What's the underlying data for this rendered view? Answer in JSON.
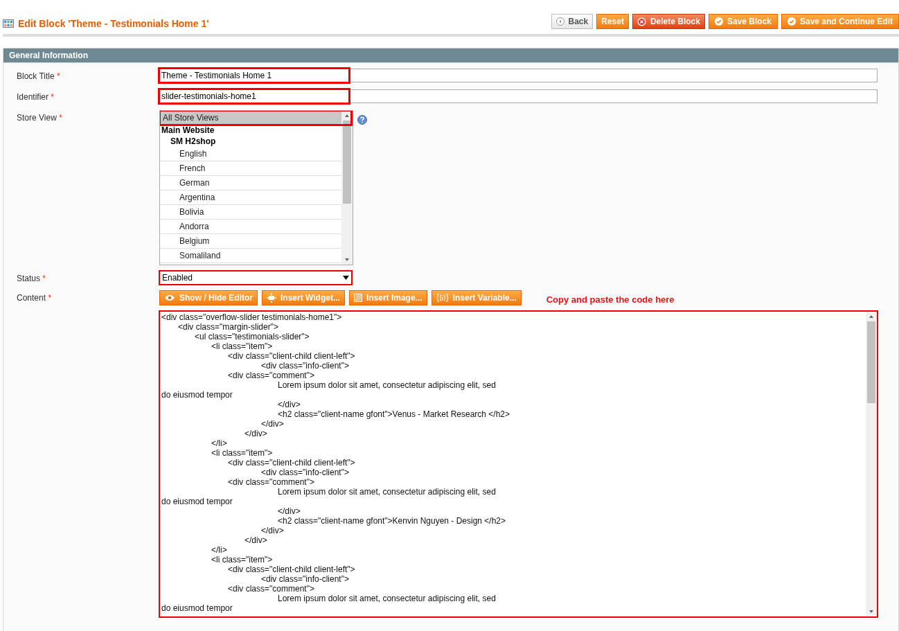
{
  "page": {
    "title": "Edit Block 'Theme - Testimonials Home 1'"
  },
  "actions": [
    {
      "label": "Back",
      "kind": "back"
    },
    {
      "label": "Reset",
      "kind": "plain"
    },
    {
      "label": "Delete Block",
      "kind": "delete"
    },
    {
      "label": "Save Block",
      "kind": "save"
    },
    {
      "label": "Save and Continue Edit",
      "kind": "save"
    }
  ],
  "section": {
    "title": "General Information"
  },
  "fields": [
    {
      "kind": "text",
      "label": "Block Title",
      "required": "*",
      "value": "Theme - Testimonials Home 1",
      "highlighted": true
    },
    {
      "kind": "text",
      "label": "Identifier",
      "required": "*",
      "value": "slider-testimonials-home1",
      "highlighted": true
    },
    {
      "kind": "multiselect",
      "label": "Store View",
      "required": "*",
      "highlighted": true,
      "options": [
        {
          "label": "All Store Views",
          "kind": "option",
          "selected": true
        },
        {
          "label": "Main Website",
          "kind": "group",
          "selected": false
        },
        {
          "label": "SM H2shop",
          "kind": "subgroup",
          "selected": false
        },
        {
          "label": "English",
          "kind": "option",
          "selected": false
        },
        {
          "label": "French",
          "kind": "option",
          "selected": false
        },
        {
          "label": "German",
          "kind": "option",
          "selected": false
        },
        {
          "label": "Argentina",
          "kind": "option",
          "selected": false
        },
        {
          "label": "Bolivia",
          "kind": "option",
          "selected": false
        },
        {
          "label": "Andorra",
          "kind": "option",
          "selected": false
        },
        {
          "label": "Belgium",
          "kind": "option",
          "selected": false
        },
        {
          "label": "Somaliland",
          "kind": "option",
          "selected": false
        }
      ]
    },
    {
      "kind": "select",
      "label": "Status",
      "required": "*",
      "value": "Enabled",
      "highlighted": true
    },
    {
      "kind": "editor",
      "label": "Content",
      "required": "*",
      "highlighted": true,
      "buttons": [
        {
          "label": "Show / Hide Editor",
          "kind": "eye"
        },
        {
          "label": "Insert Widget...",
          "kind": "widget"
        },
        {
          "label": "Insert Image...",
          "kind": "image"
        },
        {
          "label": "Insert Variable...",
          "kind": "variable"
        }
      ],
      "note": "Copy and paste the code here",
      "lines": [
        "<div class=\"overflow-slider testimonials-home1\">",
        "\t<div class=\"margin-slider\">",
        "\t\t<ul class=\"testimonials-slider\">",
        "\t\t\t<li class=\"item\">",
        "\t\t\t\t<div class=\"client-child client-left\">",
        "\t\t\t\t\t\t<div class=\"info-client\">",
        "\t\t\t\t<div class=\"comment\">",
        "\t\t\t\t\t\t\tLorem ipsum dolor sit amet, consectetur adipiscing elit, sed",
        "do eiusmod tempor",
        "\t\t\t\t\t\t\t</div>",
        "\t\t\t\t\t\t\t<h2 class=\"client-name gfont\">Venus - Market Research </h2>",
        "\t\t\t\t\t\t</div>",
        "\t\t\t\t\t</div>",
        "\t\t\t</li>",
        "\t\t\t<li class=\"item\">",
        "\t\t\t\t<div class=\"client-child client-left\">",
        "\t\t\t\t\t\t<div class=\"info-client\">",
        "\t\t\t\t<div class=\"comment\">",
        "\t\t\t\t\t\t\tLorem ipsum dolor sit amet, consectetur adipiscing elit, sed",
        "do eiusmod tempor",
        "\t\t\t\t\t\t\t</div>",
        "\t\t\t\t\t\t\t<h2 class=\"client-name gfont\">Kenvin Nguyen - Design </h2>",
        "\t\t\t\t\t\t</div>",
        "\t\t\t\t\t</div>",
        "\t\t\t</li>",
        "\t\t\t<li class=\"item\">",
        "\t\t\t\t<div class=\"client-child client-left\">",
        "\t\t\t\t\t\t<div class=\"info-client\">",
        "\t\t\t\t<div class=\"comment\">",
        "\t\t\t\t\t\t\tLorem ipsum dolor sit amet, consectetur adipiscing elit, sed",
        "do eiusmod tempor"
      ]
    }
  ]
}
